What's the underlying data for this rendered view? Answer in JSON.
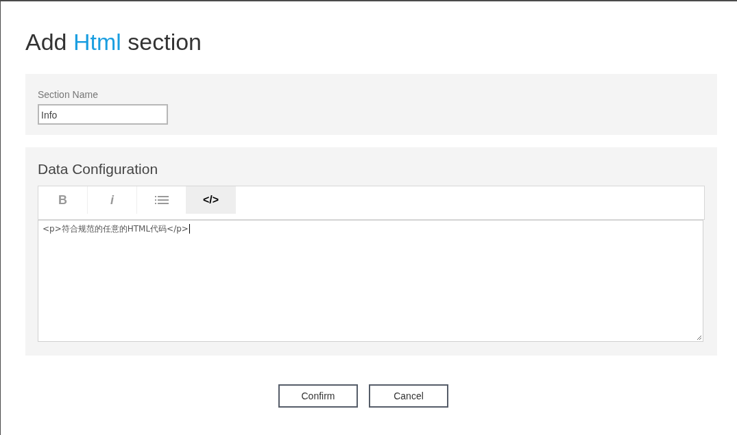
{
  "dialog": {
    "title": [
      {
        "text": "Add ",
        "highlight": false
      },
      {
        "text": "Html",
        "highlight": true
      },
      {
        "text": " section",
        "highlight": false
      }
    ]
  },
  "section_name": {
    "label": "Section Name",
    "value": "Info"
  },
  "data_configuration": {
    "heading": "Data Configuration",
    "toolbar": [
      {
        "kind": "bold",
        "label": "B",
        "selected": false
      },
      {
        "kind": "italic",
        "label": "i",
        "selected": false
      },
      {
        "kind": "list",
        "selected": false
      },
      {
        "kind": "code",
        "label": "</>",
        "selected": true
      }
    ],
    "editor": {
      "value": "<p>符合规范的任意的HTML代码</p>"
    }
  },
  "buttons": [
    "Confirm",
    "Cancel"
  ]
}
